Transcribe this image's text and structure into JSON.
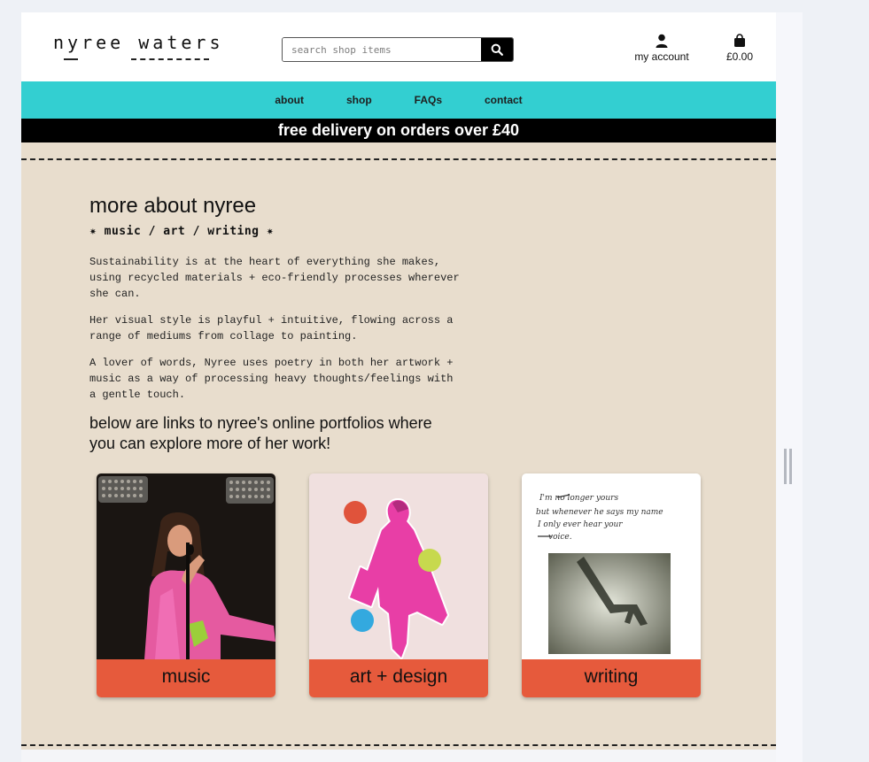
{
  "header": {
    "logo": "nyree waters",
    "search": {
      "placeholder": "search shop items"
    },
    "account_label": "my account",
    "cart_total": "£0.00"
  },
  "nav": {
    "items": [
      {
        "label": "about"
      },
      {
        "label": "shop"
      },
      {
        "label": "FAQs"
      },
      {
        "label": "contact"
      }
    ]
  },
  "promo": "free delivery on orders over £40",
  "about": {
    "title": "more about nyree",
    "subtitle": "✷ music / art / writing ✷",
    "paragraphs": [
      "Sustainability is at the heart of everything she makes, using recycled materials + eco-friendly processes wherever she can.",
      "Her visual style is playful + intuitive, flowing across a range of mediums from collage to painting.",
      "A lover of words, Nyree uses poetry in both her artwork + music as a way of processing heavy thoughts/feelings with a gentle touch."
    ],
    "lead": "below are links to nyree's online portfolios where you can explore more of her work!"
  },
  "cards": [
    {
      "label": "music"
    },
    {
      "label": "art + design"
    },
    {
      "label": "writing"
    }
  ],
  "writing_card": {
    "handwriting": [
      "I'm no longer yours",
      "but whenever he says my name",
      "I only ever hear your",
      "voice."
    ]
  },
  "colors": {
    "nav": "#33cfd1",
    "promo": "#000000",
    "main_bg": "#e8ddcd",
    "card_label": "#e65a3c"
  }
}
